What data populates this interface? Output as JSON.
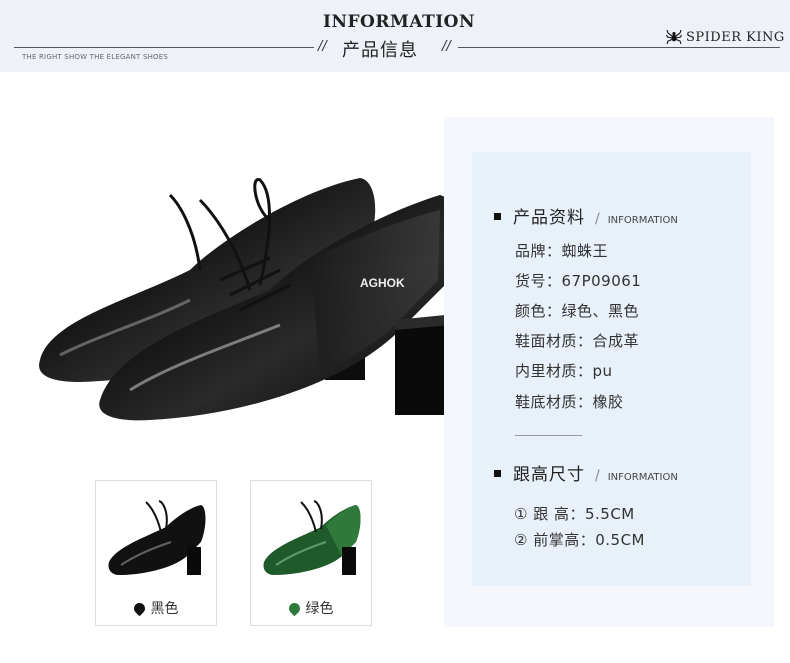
{
  "header": {
    "title_en": "INFORMATION",
    "title_zh": "产品信息",
    "slash": "//",
    "tagline": "THE RIGHT SHOW THE ELEGANT SHOES",
    "brand": "SPIDER KING",
    "brand_icon": "spider-icon"
  },
  "product": {
    "main_image": "black-patent-lace-up-heeled-shoes",
    "shoe_print": "AGHOK"
  },
  "info": {
    "section_title": "产品资料",
    "section_en": "INFORMATION",
    "slash": "/",
    "specs": [
      "品牌：蜘蛛王",
      "货号：67P09061",
      "颜色：绿色、黑色",
      "鞋面材质：合成革",
      "内里材质：pu",
      "鞋底材质：橡胶"
    ]
  },
  "size": {
    "section_title": "跟高尺寸",
    "section_en": "INFORMATION",
    "slash": "/",
    "items": [
      "① 跟  高：5.5CM",
      "② 前掌高：0.5CM"
    ]
  },
  "colors": [
    {
      "label": "黑色",
      "hex": "#111111"
    },
    {
      "label": "绿色",
      "hex": "#2f7a3a"
    }
  ]
}
